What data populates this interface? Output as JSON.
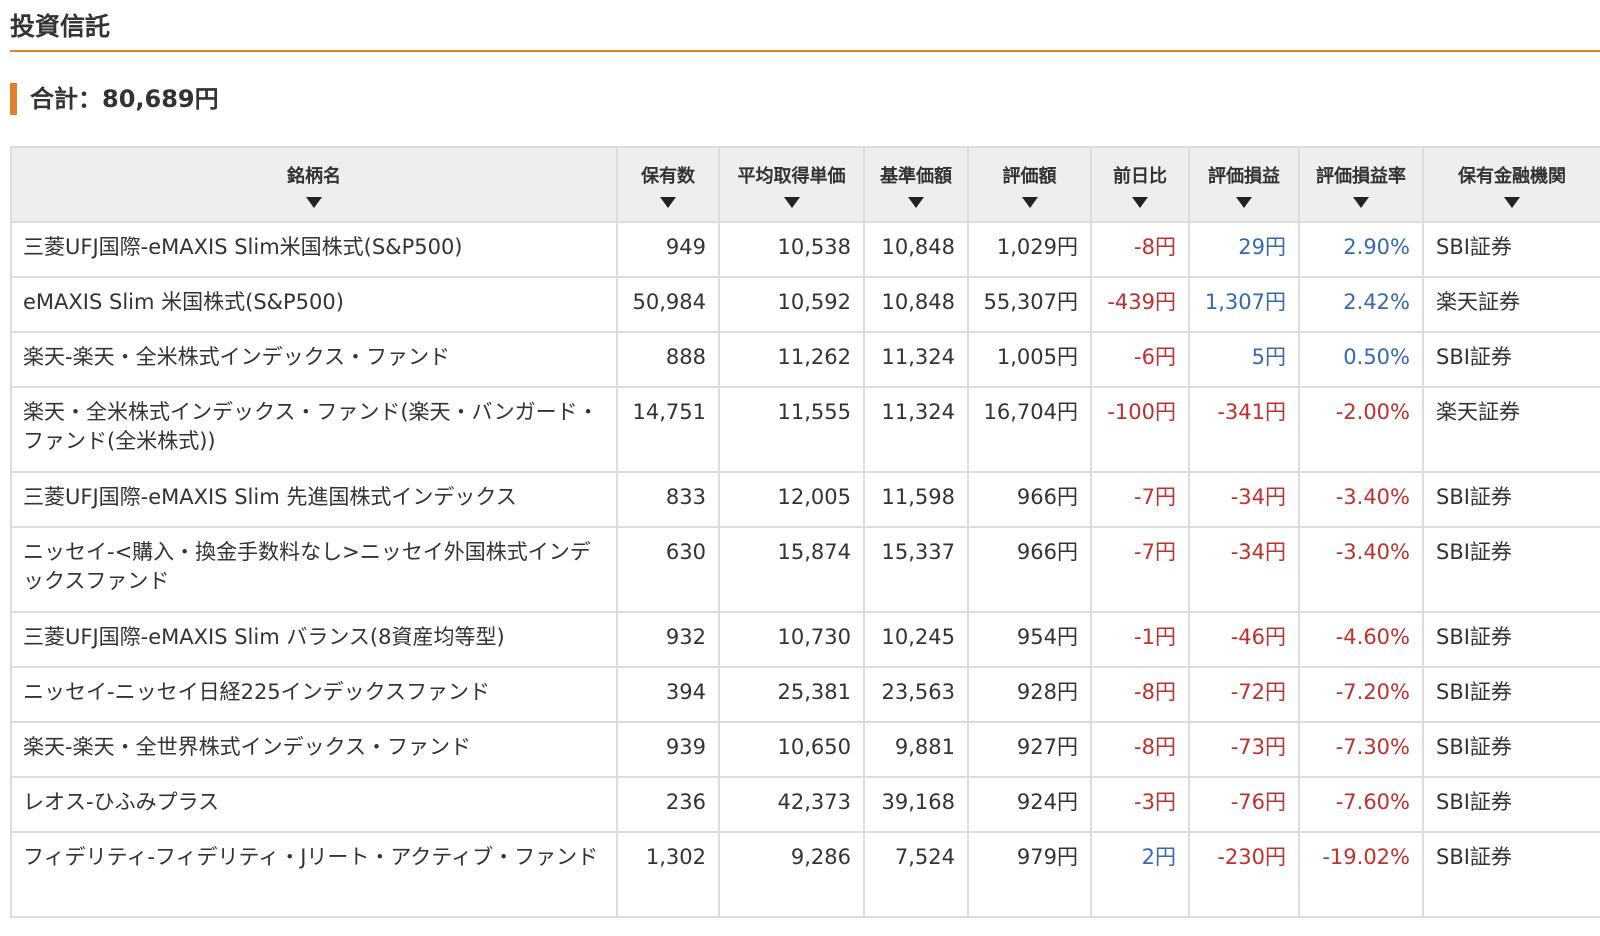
{
  "section_title": "投資信託",
  "total_label": "合計：80,689円",
  "columns": [
    "銘柄名",
    "保有数",
    "平均取得単価",
    "基準価額",
    "評価額",
    "前日比",
    "評価損益",
    "評価損益率",
    "保有金融機関"
  ],
  "rows": [
    {
      "name": "三菱UFJ国際-eMAXIS Slim米国株式(S&P500)",
      "qty": "949",
      "avg": "10,538",
      "nav": "10,848",
      "value": "1,029円",
      "daychg": "-8円",
      "pl": "29円",
      "plrate": "2.90%",
      "inst": "SBI証券",
      "day_sign": "neg",
      "pl_sign": "pos",
      "lines": 1
    },
    {
      "name": "eMAXIS Slim 米国株式(S&P500)",
      "qty": "50,984",
      "avg": "10,592",
      "nav": "10,848",
      "value": "55,307円",
      "daychg": "-439円",
      "pl": "1,307円",
      "plrate": "2.42%",
      "inst": "楽天証券",
      "day_sign": "neg",
      "pl_sign": "pos",
      "lines": 1
    },
    {
      "name": "楽天-楽天・全米株式インデックス・ファンド",
      "qty": "888",
      "avg": "11,262",
      "nav": "11,324",
      "value": "1,005円",
      "daychg": "-6円",
      "pl": "5円",
      "plrate": "0.50%",
      "inst": "SBI証券",
      "day_sign": "neg",
      "pl_sign": "pos",
      "lines": 1
    },
    {
      "name": "楽天・全米株式インデックス・ファンド(楽天・バンガード・ファンド(全米株式))",
      "qty": "14,751",
      "avg": "11,555",
      "nav": "11,324",
      "value": "16,704円",
      "daychg": "-100円",
      "pl": "-341円",
      "plrate": "-2.00%",
      "inst": "楽天証券",
      "day_sign": "neg",
      "pl_sign": "neg",
      "lines": 2
    },
    {
      "name": "三菱UFJ国際-eMAXIS Slim 先進国株式インデックス",
      "qty": "833",
      "avg": "12,005",
      "nav": "11,598",
      "value": "966円",
      "daychg": "-7円",
      "pl": "-34円",
      "plrate": "-3.40%",
      "inst": "SBI証券",
      "day_sign": "neg",
      "pl_sign": "neg",
      "lines": 1
    },
    {
      "name": "ニッセイ-<購入・換金手数料なし>ニッセイ外国株式インデックスファンド",
      "qty": "630",
      "avg": "15,874",
      "nav": "15,337",
      "value": "966円",
      "daychg": "-7円",
      "pl": "-34円",
      "plrate": "-3.40%",
      "inst": "SBI証券",
      "day_sign": "neg",
      "pl_sign": "neg",
      "lines": 2
    },
    {
      "name": "三菱UFJ国際-eMAXIS Slim バランス(8資産均等型)",
      "qty": "932",
      "avg": "10,730",
      "nav": "10,245",
      "value": "954円",
      "daychg": "-1円",
      "pl": "-46円",
      "plrate": "-4.60%",
      "inst": "SBI証券",
      "day_sign": "neg",
      "pl_sign": "neg",
      "lines": 1
    },
    {
      "name": "ニッセイ-ニッセイ日経225インデックスファンド",
      "qty": "394",
      "avg": "25,381",
      "nav": "23,563",
      "value": "928円",
      "daychg": "-8円",
      "pl": "-72円",
      "plrate": "-7.20%",
      "inst": "SBI証券",
      "day_sign": "neg",
      "pl_sign": "neg",
      "lines": 1
    },
    {
      "name": "楽天-楽天・全世界株式インデックス・ファンド",
      "qty": "939",
      "avg": "10,650",
      "nav": "9,881",
      "value": "927円",
      "daychg": "-8円",
      "pl": "-73円",
      "plrate": "-7.30%",
      "inst": "SBI証券",
      "day_sign": "neg",
      "pl_sign": "neg",
      "lines": 1
    },
    {
      "name": "レオス-ひふみプラス",
      "qty": "236",
      "avg": "42,373",
      "nav": "39,168",
      "value": "924円",
      "daychg": "-3円",
      "pl": "-76円",
      "plrate": "-7.60%",
      "inst": "SBI証券",
      "day_sign": "neg",
      "pl_sign": "neg",
      "lines": 1
    },
    {
      "name": "フィデリティ-フィデリティ・Jリート・アクティブ・ファンド",
      "qty": "1,302",
      "avg": "9,286",
      "nav": "7,524",
      "value": "979円",
      "daychg": "2円",
      "pl": "-230円",
      "plrate": "-19.02%",
      "inst": "SBI証券",
      "day_sign": "pos",
      "pl_sign": "neg",
      "lines": 2
    }
  ],
  "colors": {
    "accent": "#e07f2c",
    "negative": "#c0302d",
    "positive": "#3469b0",
    "header_bg": "#eeeeee",
    "border": "#dddddd"
  }
}
